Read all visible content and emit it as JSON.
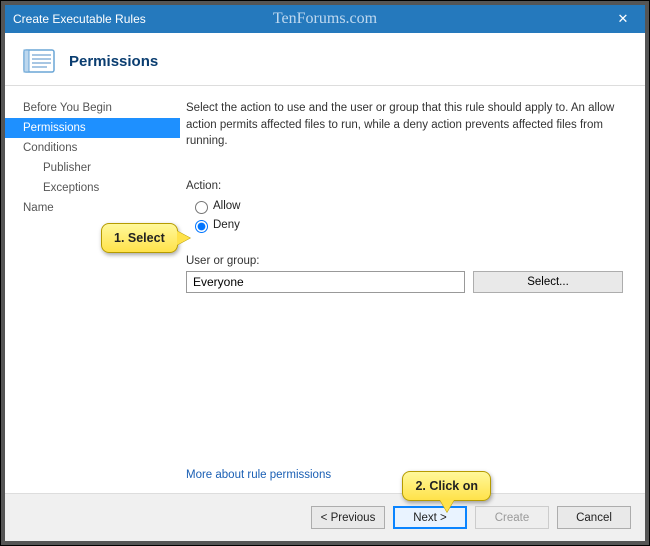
{
  "window": {
    "title": "Create Executable Rules",
    "watermark": "TenForums.com"
  },
  "header": {
    "title": "Permissions"
  },
  "sidebar": {
    "items": [
      {
        "label": "Before You Begin"
      },
      {
        "label": "Permissions"
      },
      {
        "label": "Conditions"
      },
      {
        "label": "Publisher"
      },
      {
        "label": "Exceptions"
      },
      {
        "label": "Name"
      }
    ]
  },
  "content": {
    "description": "Select the action to use and the user or group that this rule should apply to. An allow action permits affected files to run, while a deny action prevents affected files from running.",
    "action_label": "Action:",
    "radio_allow": "Allow",
    "radio_deny": "Deny",
    "selected_action": "deny",
    "user_group_label": "User or group:",
    "user_group_value": "Everyone",
    "select_button": "Select...",
    "more_link": "More about rule permissions"
  },
  "footer": {
    "previous": "< Previous",
    "next": "Next >",
    "create": "Create",
    "cancel": "Cancel"
  },
  "annotations": {
    "step1": "1. Select",
    "step2": "2. Click on"
  }
}
